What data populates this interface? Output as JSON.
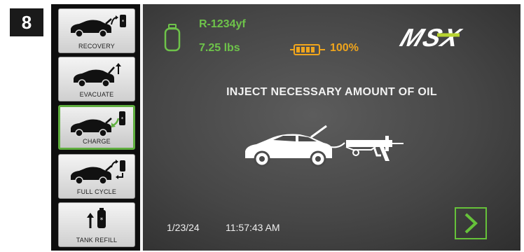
{
  "step": "8",
  "sidebar": {
    "items": [
      {
        "label": "RECOVERY",
        "icon": "car-tank-recovery-icon"
      },
      {
        "label": "EVACUATE",
        "icon": "car-evacuate-icon"
      },
      {
        "label": "CHARGE",
        "icon": "car-charge-icon",
        "active": true
      },
      {
        "label": "FULL CYCLE",
        "icon": "car-full-cycle-icon"
      },
      {
        "label": "TANK REFILL",
        "icon": "tank-refill-icon"
      }
    ]
  },
  "status": {
    "refrigerant": "R-1234yf",
    "weight": "7.25 lbs",
    "battery_percent": "100%"
  },
  "logo": {
    "text": "MSX"
  },
  "main": {
    "instruction": "INJECT NECESSARY AMOUNT OF OIL"
  },
  "footer": {
    "date": "1/23/24",
    "time": "11:57:43 AM"
  },
  "colors": {
    "accent_green": "#6ec34a",
    "battery_orange": "#f0a51c",
    "active_border": "#5fae3f",
    "screen_bg": "#464646"
  }
}
